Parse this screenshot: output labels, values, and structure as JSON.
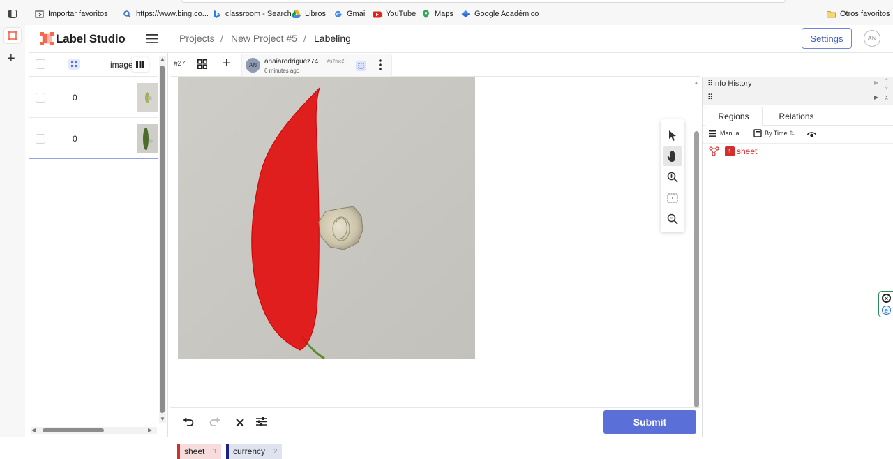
{
  "browser": {
    "bookmarks": [
      {
        "label": "Importar favoritos",
        "icon": "import-icon"
      },
      {
        "label": "https://www.bing.co...",
        "icon": "search-icon"
      },
      {
        "label": "classroom - Search",
        "icon": "bing-icon"
      },
      {
        "label": "Libros",
        "icon": "drive-icon"
      },
      {
        "label": "Gmail",
        "icon": "google-icon"
      },
      {
        "label": "YouTube",
        "icon": "youtube-icon"
      },
      {
        "label": "Maps",
        "icon": "maps-pin-icon"
      },
      {
        "label": "Google Académico",
        "icon": "scholar-icon"
      }
    ],
    "other_favorites": "Otros favoritos"
  },
  "header": {
    "app_name": "Label Studio",
    "breadcrumbs": [
      "Projects",
      "New Project #5",
      "Labeling"
    ],
    "settings_label": "Settings",
    "user_initials": "AN"
  },
  "task_list": {
    "column_label": "image",
    "rows": [
      {
        "value": "0",
        "selected": false
      },
      {
        "value": "0",
        "selected": true
      }
    ]
  },
  "annotation": {
    "task_number": "#27",
    "avatar": "AN",
    "username": "anaiarodriguez74",
    "annotation_id": "#s7mc2",
    "time": "6 minutes ago"
  },
  "labels": [
    {
      "name": "sheet",
      "hotkey": "1",
      "color": "#d32f2f",
      "bg": "#f7dcdc"
    },
    {
      "name": "currency",
      "hotkey": "2",
      "color": "#1a237e",
      "bg": "#dfe2ef"
    }
  ],
  "actions": {
    "submit_label": "Submit"
  },
  "right_panel": {
    "info_history": "Info History",
    "tabs": [
      "Regions",
      "Relations"
    ],
    "manual_label": "Manual",
    "sort_label": "By Time",
    "regions": [
      {
        "index": "1",
        "label": "sheet",
        "color": "#d32f2f"
      }
    ]
  }
}
